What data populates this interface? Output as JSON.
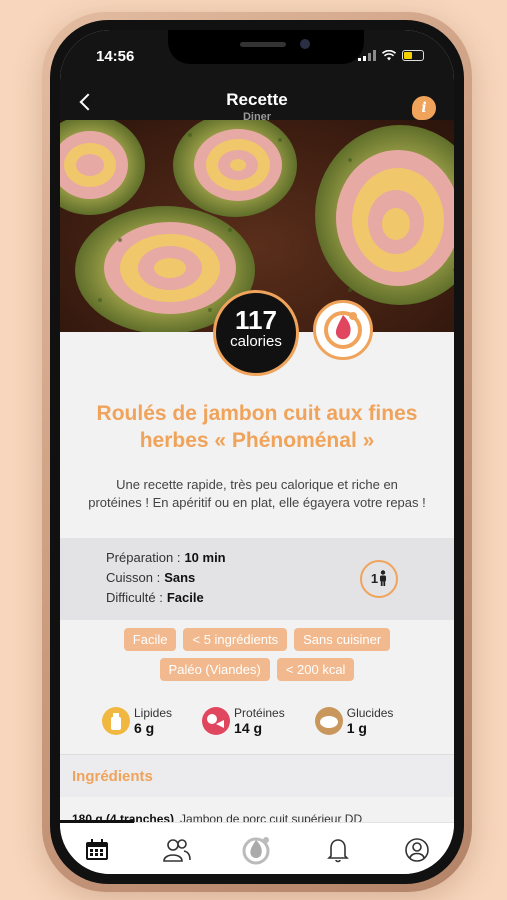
{
  "status_bar": {
    "time": "14:56"
  },
  "header": {
    "title": "Recette",
    "subtitle": "Diner",
    "info_glyph": "i"
  },
  "recipe": {
    "calories_value": "117",
    "calories_label": "calories",
    "title": "Roulés de jambon cuit aux fines herbes « Phénoménal »",
    "description": "Une recette rapide, très peu calorique et riche en protéines ! En apéritif ou en plat, elle égayera votre repas !",
    "meta": [
      {
        "label": "Préparation :",
        "value": "10 min"
      },
      {
        "label": "Cuisson :",
        "value": "Sans"
      },
      {
        "label": "Difficulté :",
        "value": "Facile"
      }
    ],
    "servings": "1",
    "tags": [
      "Facile",
      "< 5 ingrédients",
      "Sans cuisiner",
      "Paléo (Viandes)",
      "< 200 kcal"
    ],
    "macros": [
      {
        "name": "Lipides",
        "value": "6 g",
        "color": "#f0b840",
        "icon": "bottle-icon"
      },
      {
        "name": "Protéines",
        "value": "14 g",
        "color": "#e0475f",
        "icon": "fish-meat-icon"
      },
      {
        "name": "Glucides",
        "value": "1 g",
        "color": "#c9965c",
        "icon": "bread-icon"
      }
    ]
  },
  "ingredients": {
    "title": "Ingrédients",
    "items": [
      {
        "quantity": "180 g (4 tranches)",
        "name": "Jambon de porc cuit supérieur DD"
      }
    ]
  },
  "tabbar": {
    "items": [
      "calendar-icon",
      "community-icon",
      "app-logo-icon",
      "bell-icon",
      "profile-icon"
    ],
    "active_index": 0
  },
  "colors": {
    "accent": "#f0a35a",
    "header_bg": "#141414",
    "tag_bg": "#f2b98e"
  }
}
